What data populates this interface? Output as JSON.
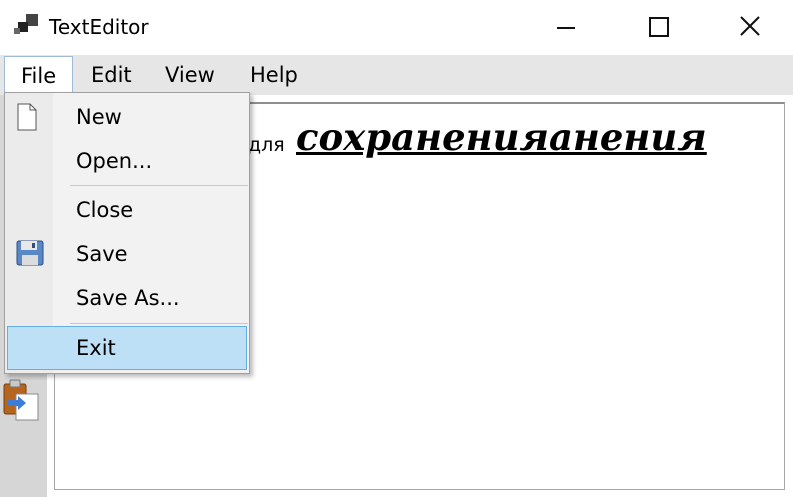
{
  "window": {
    "title": "TextEditor",
    "controls": {
      "minimize": "minimize-icon",
      "maximize": "maximize-icon",
      "close": "close-icon"
    }
  },
  "menubar": {
    "items": [
      {
        "label": "File",
        "open": true
      },
      {
        "label": "Edit"
      },
      {
        "label": "View"
      },
      {
        "label": "Help"
      }
    ]
  },
  "file_menu": {
    "items": [
      {
        "label": "New",
        "icon": "new-document-icon"
      },
      {
        "label": "Open..."
      },
      {
        "label": "Close"
      },
      {
        "label": "Save",
        "icon": "floppy-disk-icon"
      },
      {
        "label": "Save As..."
      },
      {
        "label": "Exit",
        "highlighted": true
      }
    ],
    "highlight_color": "#bde0f7"
  },
  "document": {
    "text_small": "для",
    "text_large": "сохраненияанения"
  },
  "toolbar": {
    "icons": [
      "paste-icon"
    ]
  }
}
